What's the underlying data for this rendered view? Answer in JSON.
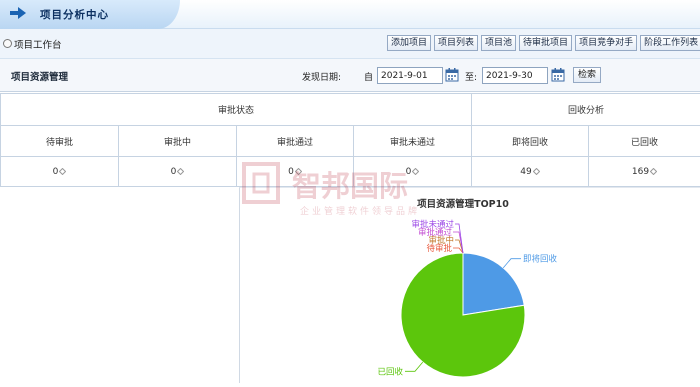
{
  "header": {
    "title": "项目分析中心",
    "arrow_icon": "arrow-right-icon"
  },
  "toolbar": {
    "workbench_label": "项目工作台",
    "buttons": [
      "添加项目",
      "项目列表",
      "项目池",
      "待审批项目",
      "项目竞争对手",
      "阶段工作列表"
    ]
  },
  "filter": {
    "section_title": "项目资源管理",
    "date_label": "发现日期:",
    "from_label": "自",
    "from_value": "2021-9-01",
    "to_label": "至:",
    "to_value": "2021-9-30",
    "search_label": "检索"
  },
  "table": {
    "group_headers": [
      "审批状态",
      "回收分析"
    ],
    "columns": [
      "待审批",
      "审批中",
      "审批通过",
      "审批未通过",
      "即将回收",
      "已回收"
    ],
    "values": [
      "0",
      "0",
      "0",
      "0",
      "49",
      "169"
    ]
  },
  "watermark": {
    "text": "智邦国际",
    "subtext": "企业管理软件领导品牌"
  },
  "chart_data": {
    "type": "pie",
    "title": "项目资源管理TOP10",
    "categories": [
      "待审批",
      "审批中",
      "审批通过",
      "审批未通过",
      "即将回收",
      "已回收"
    ],
    "values": [
      0,
      0,
      0,
      0,
      49,
      169
    ],
    "colors": [
      "#e8573a",
      "#c0762a",
      "#c24bd2",
      "#9a45e6",
      "#4e9ae6",
      "#5cc60c"
    ],
    "legend": "none"
  }
}
